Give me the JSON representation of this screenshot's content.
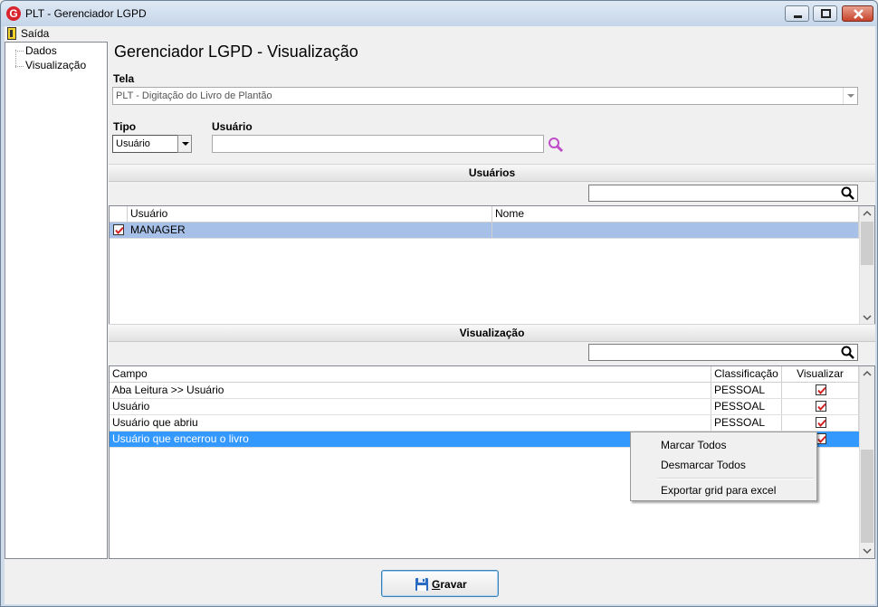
{
  "window": {
    "title": "PLT - Gerenciador LGPD",
    "app_icon_letter": "G"
  },
  "menubar": {
    "exit_label": "Saída"
  },
  "tree": {
    "items": [
      "Dados",
      "Visualização"
    ]
  },
  "main": {
    "title": "Gerenciador LGPD - Visualização",
    "tela_label": "Tela",
    "tela_value": "PLT - Digitação do Livro de Plantão",
    "tipo_label": "Tipo",
    "tipo_value": "Usuário",
    "usuario_label": "Usuário",
    "usuario_value": ""
  },
  "usuarios_section": {
    "header": "Usuários",
    "search_value": "",
    "columns": [
      "Usuário",
      "Nome"
    ],
    "rows": [
      {
        "checked": true,
        "usuario": "MANAGER",
        "nome": ""
      }
    ]
  },
  "visualizacao_section": {
    "header": "Visualização",
    "search_value": "",
    "columns": [
      "Campo",
      "Classificação",
      "Visualizar"
    ],
    "rows": [
      {
        "campo": "Aba Leitura >> Usuário",
        "classificacao": "PESSOAL",
        "visualizar": true
      },
      {
        "campo": "Usuário",
        "classificacao": "PESSOAL",
        "visualizar": true
      },
      {
        "campo": "Usuário que abriu",
        "classificacao": "PESSOAL",
        "visualizar": true
      },
      {
        "campo": "Usuário que encerrou o livro",
        "classificacao": "",
        "visualizar": true
      }
    ]
  },
  "context_menu": {
    "items": [
      "Marcar Todos",
      "Desmarcar Todos",
      "Exportar grid para excel"
    ]
  },
  "footer": {
    "save_label": "Gravar"
  },
  "colors": {
    "selection_blue": "#3399ff",
    "selection_light": "#a7c0e8",
    "check_red": "#d21f1f",
    "search_icon_magenta": "#c04bc8"
  }
}
